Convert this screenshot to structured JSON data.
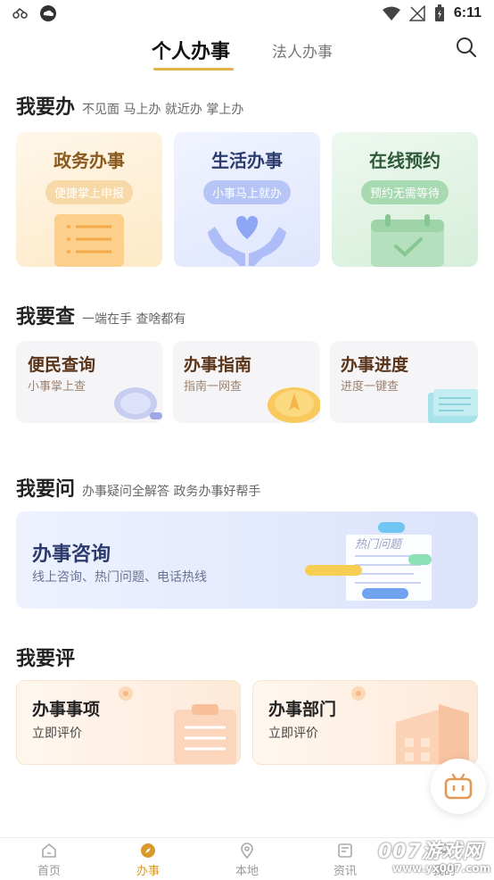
{
  "status_bar": {
    "time": "6:11"
  },
  "top_tabs": {
    "personal": "个人办事",
    "legal": "法人办事"
  },
  "section_do": {
    "title": "我要办",
    "subtitle": "不见面 马上办 就近办 掌上办",
    "cards": [
      {
        "title": "政务办事",
        "pill": "便捷掌上申报"
      },
      {
        "title": "生活办事",
        "pill": "小事马上就办"
      },
      {
        "title": "在线预约",
        "pill": "预约无需等待"
      }
    ]
  },
  "section_query": {
    "title": "我要查",
    "subtitle": "一端在手 查啥都有",
    "cards": [
      {
        "title": "便民查询",
        "sub": "小事掌上查"
      },
      {
        "title": "办事指南",
        "sub": "指南一网查"
      },
      {
        "title": "办事进度",
        "sub": "进度一键查"
      }
    ]
  },
  "section_ask": {
    "title": "我要问",
    "subtitle": "办事疑问全解答 政务办事好帮手",
    "card": {
      "title": "办事咨询",
      "sub": "线上咨询、热门问题、电话热线",
      "illus_text": "热门问题"
    }
  },
  "section_rate": {
    "title": "我要评",
    "cards": [
      {
        "title": "办事事项",
        "sub": "立即评价"
      },
      {
        "title": "办事部门",
        "sub": "立即评价"
      }
    ]
  },
  "bottom_nav": [
    {
      "label": "首页",
      "icon": "home-icon",
      "active": false
    },
    {
      "label": "办事",
      "icon": "compass-icon",
      "active": true
    },
    {
      "label": "本地",
      "icon": "location-icon",
      "active": false
    },
    {
      "label": "资讯",
      "icon": "news-icon",
      "active": false
    },
    {
      "label": "我的",
      "icon": "user-icon",
      "active": false
    }
  ],
  "watermark": {
    "line1": "007游戏网",
    "line2": "www.yx007.com"
  },
  "colors": {
    "accent": "#e1b14a",
    "active_nav": "#d89a2b"
  }
}
